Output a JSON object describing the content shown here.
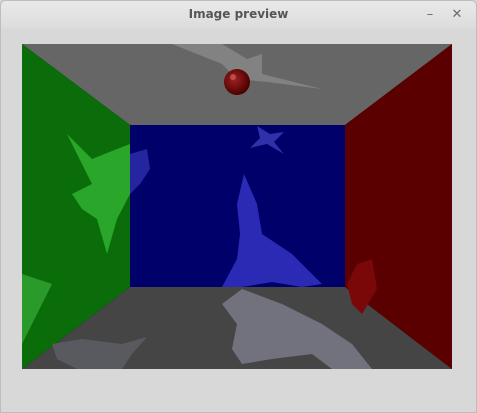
{
  "window": {
    "title": "Image preview",
    "minimize_glyph": "–",
    "close_glyph": "✕"
  },
  "preview": {
    "scene": {
      "wall_colors": {
        "left": "#0a6d0a",
        "back": "#00006b",
        "right": "#5a0000",
        "ceiling": "#666666",
        "floor": "#454545"
      },
      "sphere_color": "#7a0a0a"
    }
  }
}
